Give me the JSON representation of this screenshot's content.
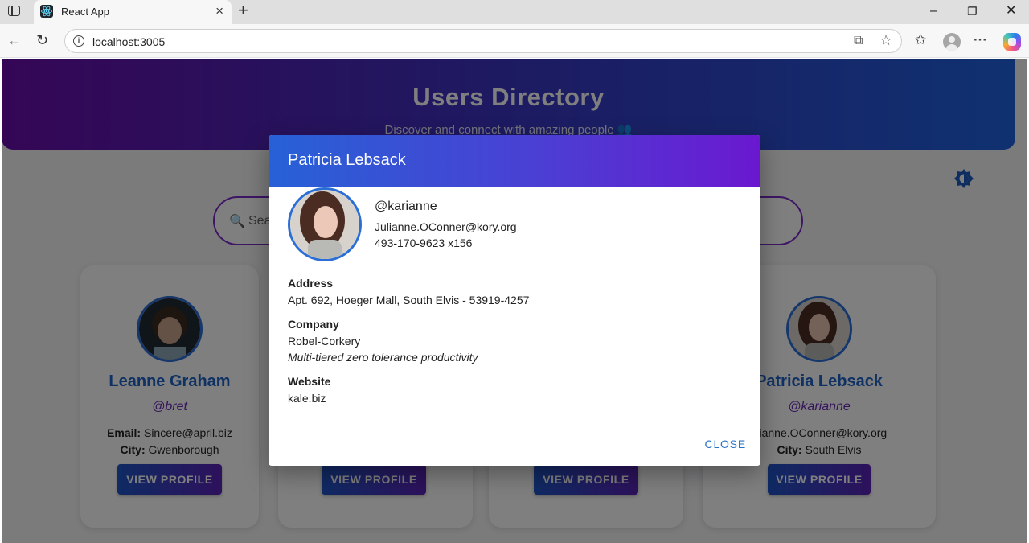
{
  "browser": {
    "tab_title": "React App",
    "url": "localhost:3005",
    "icons": {
      "sidebar": "window-icon",
      "close_tab": "×",
      "new_tab": "+",
      "back": "←",
      "reload": "↻",
      "minimize": "–",
      "restore": "❐",
      "close": "✕",
      "split": "⧉",
      "star": "☆",
      "favorites": "✩",
      "more": "···"
    }
  },
  "header": {
    "title": "Users Directory",
    "subtitle": "Discover and connect with amazing people 👥"
  },
  "search": {
    "icon": "🔍",
    "placeholder": "Sea"
  },
  "cards": [
    {
      "name": "Leanne Graham",
      "handle": "@bret",
      "email_label": "Email:",
      "email": "Sincere@april.biz",
      "city_label": "City:",
      "city": "Gwenborough",
      "button": "VIEW PROFILE"
    },
    {
      "button": "VIEW PROFILE"
    },
    {
      "button": "VIEW PROFILE"
    },
    {
      "name": "Patricia Lebsack",
      "handle": "@karianne",
      "email_partial": ": Julianne.OConner@kory.org",
      "city_label": "City:",
      "city": "South Elvis",
      "button": "VIEW PROFILE"
    }
  ],
  "dialog": {
    "title": "Patricia Lebsack",
    "username": "@karianne",
    "email": "Julianne.OConner@kory.org",
    "phone": "493-170-9623 x156",
    "address_label": "Address",
    "address": "Apt. 692, Hoeger Mall, South Elvis - 53919-4257",
    "company_label": "Company",
    "company_name": "Robel-Corkery",
    "company_catchphrase": "Multi-tiered zero tolerance productivity",
    "website_label": "Website",
    "website": "kale.biz",
    "close_label": "CLOSE"
  },
  "colors": {
    "accent_blue": "#1e63c6",
    "accent_purple": "#6a18d0",
    "close_link": "#2672c8"
  }
}
